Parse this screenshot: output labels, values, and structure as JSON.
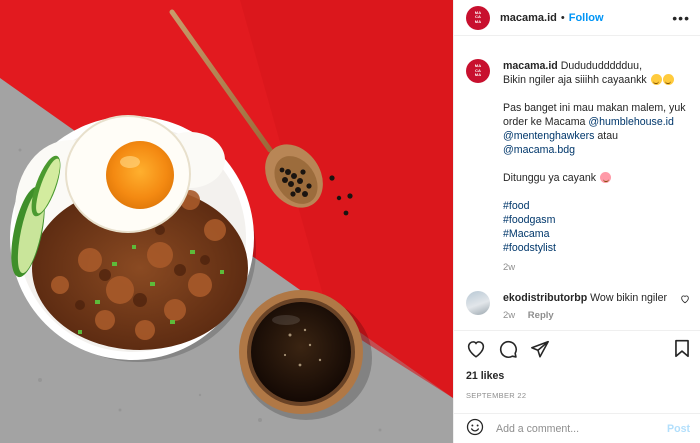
{
  "post": {
    "username": "macama.id",
    "follow_label": "Follow",
    "more_glyph": "•••",
    "avatar_text": "MA\nCA\nMA"
  },
  "caption": {
    "username": "macama.id",
    "line1": "Dudududdddduu,",
    "line2": "Bikin ngiler aja siiihh cayaankk",
    "para2_a": "Pas banget ini mau makan malem, yuk order ke Macama ",
    "mention1": "@humblehouse.id",
    "mention2": "@mentenghawkers",
    "para2_b": " atau ",
    "mention3": "@macama.bdg",
    "para3": "Ditunggu ya cayank",
    "tags": [
      "#food",
      "#foodgasm",
      "#Macama",
      "#foodstylist"
    ],
    "time": "2w"
  },
  "comment": {
    "username": "ekodistributorbp",
    "text": "Wow bikin ngiler",
    "time": "2w",
    "reply_label": "Reply"
  },
  "likes": "21 likes",
  "date": "SEPTEMBER 22",
  "add_comment": {
    "placeholder": "Add a comment...",
    "post_label": "Post"
  },
  "icons": {
    "like": "heart-icon",
    "comment": "comment-icon",
    "share": "share-icon",
    "save": "bookmark-icon",
    "emoji": "smiley-icon"
  },
  "colors": {
    "brand_red": "#c8102e",
    "follow_blue": "#0095f6",
    "link_blue": "#00376b",
    "muted": "#8e8e8e"
  }
}
